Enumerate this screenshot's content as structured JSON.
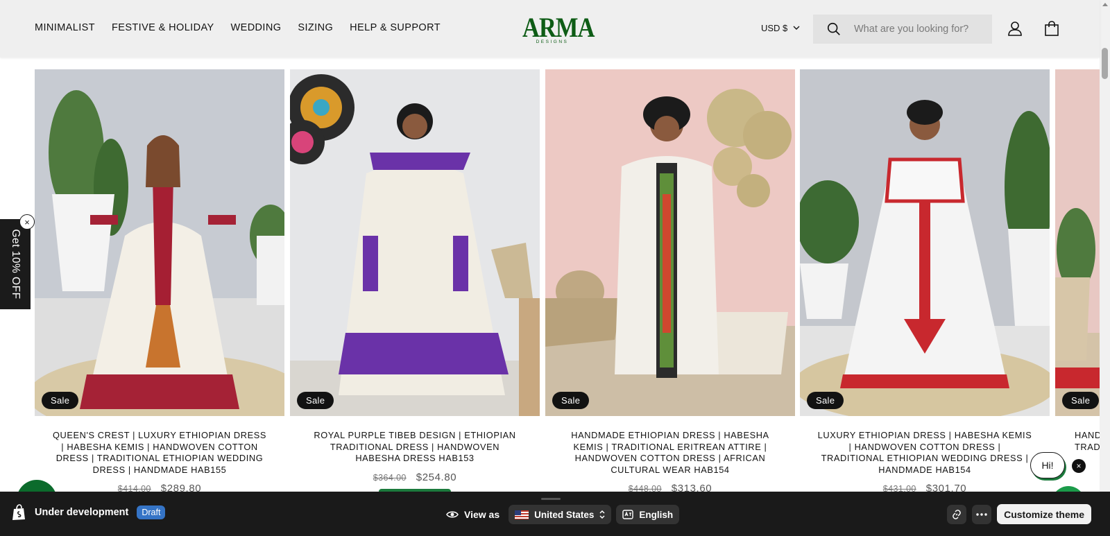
{
  "header": {
    "nav": [
      "MINIMALIST",
      "FESTIVE & HOLIDAY",
      "WEDDING",
      "SIZING",
      "HELP & SUPPORT"
    ],
    "logo_main": "ARMA",
    "logo_sub": "DESIGNS",
    "currency": "USD $",
    "search_placeholder": "What are you looking for?"
  },
  "products": [
    {
      "sale_label": "Sale",
      "title": "QUEEN'S CREST | LUXURY ETHIOPIAN DRESS | HABESHA KEMIS | HANDWOVEN COTTON DRESS | TRADITIONAL ETHIOPIAN WEDDING DRESS | HANDMADE HAB155",
      "old_price": "$414.00",
      "price": "$289.80"
    },
    {
      "sale_label": "Sale",
      "title": "ROYAL PURPLE TIBEB DESIGN | ETHIOPIAN TRADITIONAL DRESS | HANDWOVEN HABESHA DRESS HAB153",
      "old_price": "$364.00",
      "price": "$254.80"
    },
    {
      "sale_label": "Sale",
      "title": "HANDMADE ETHIOPIAN DRESS | HABESHA KEMIS | TRADITIONAL ERITREAN ATTIRE | HANDWOVEN COTTON DRESS | AFRICAN CULTURAL WEAR HAB154",
      "old_price": "$448.00",
      "price": "$313.60"
    },
    {
      "sale_label": "Sale",
      "title": "LUXURY ETHIOPIAN DRESS | HABESHA KEMIS | HANDWOVEN COTTON DRESS | TRADITIONAL ETHIOPIAN WEDDING DRESS | HANDMADE HAB154",
      "old_price": "$431.00",
      "price": "$301.70"
    },
    {
      "sale_label": "Sale",
      "title": "HANDMADE ETHIOPIAN DRESS | TRADITIONAL",
      "old_price": "",
      "price": ""
    }
  ],
  "popup": {
    "side_tab": "Get 10% OFF",
    "close": "×"
  },
  "chat": {
    "bubble": "Hi!",
    "close": "×"
  },
  "bottom_bar": {
    "status": "Under development",
    "badge": "Draft",
    "view_as": "View as",
    "country": "United States",
    "language": "English",
    "customize": "Customize theme"
  },
  "colors": {
    "brand_green": "#0e5c16",
    "accent_green": "#1b7a3c",
    "draft_blue": "#3574c6"
  }
}
